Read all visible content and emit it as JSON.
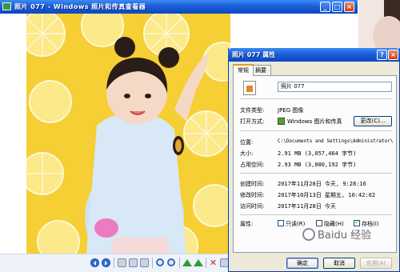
{
  "viewer": {
    "title": "照片 077 - Windows 照片和传真查看器"
  },
  "dialog": {
    "title": "照片 077 属性",
    "tabs": [
      "常规",
      "摘要"
    ],
    "file_name": "照片 077",
    "rows": {
      "file_type": {
        "label": "文件类型:",
        "value": "JPEG 图像"
      },
      "open_with": {
        "label": "打开方式:",
        "value": "Windows 图片和传真",
        "button": "更改(C)..."
      },
      "location": {
        "label": "位置:",
        "value": "C:\\Documents and Settings\\Administrator\\"
      },
      "size": {
        "label": "大小:",
        "value": "2.91 MB (3,057,464 字节)"
      },
      "size_on_disk": {
        "label": "占用空间:",
        "value": "2.93 MB (3,080,192 字节)"
      },
      "created": {
        "label": "创建时间:",
        "value": "2017年11月28日 今天, 9:28:16"
      },
      "modified": {
        "label": "修改时间:",
        "value": "2017年10月13日 星期五, 10:42:02"
      },
      "accessed": {
        "label": "访问时间:",
        "value": "2017年11月28日 今天"
      }
    },
    "attributes": {
      "label": "属性:",
      "read_only": {
        "label": "只读(R)",
        "checked": false
      },
      "hidden": {
        "label": "隐藏(H)",
        "checked": false
      },
      "archive": {
        "label": "存档(I)",
        "checked": true
      }
    },
    "buttons": {
      "ok": "确定",
      "cancel": "取消",
      "apply": "应用(A)"
    },
    "title_buttons": {
      "help": "?",
      "close": "×"
    }
  },
  "watermark": "Baidu 经验",
  "icons": {
    "viewer_title": "photo-viewer-app-icon",
    "file": "jpeg-file-icon",
    "program": "photo-viewer-program-icon"
  },
  "colors": {
    "titlebar": "#1c5ed8",
    "photo_background": "#f7d23a",
    "dialog_face": "#ece9d8"
  }
}
